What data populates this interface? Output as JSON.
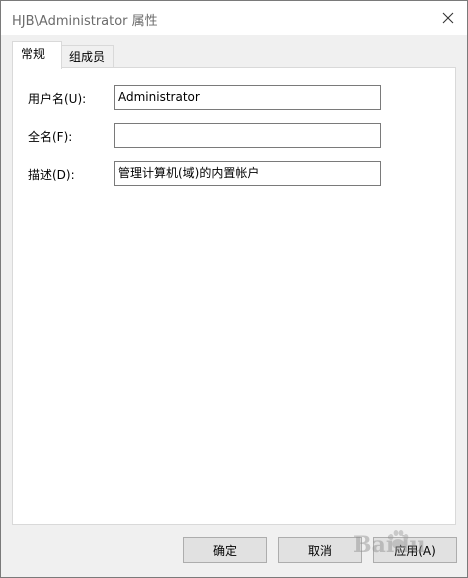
{
  "window": {
    "title": "HJB\\Administrator 属性"
  },
  "tabs": [
    {
      "label": "常规",
      "active": true
    },
    {
      "label": "组成员",
      "active": false
    }
  ],
  "fields": {
    "username": {
      "label": "用户名(U):",
      "value": "Administrator"
    },
    "fullname": {
      "label": "全名(F):",
      "value": ""
    },
    "description": {
      "label": "描述(D):",
      "value": "管理计算机(域)的内置帐户"
    }
  },
  "buttons": {
    "ok": "确定",
    "cancel": "取消",
    "apply": "应用(A)"
  },
  "watermark": {
    "brand": "Baidu"
  },
  "icons": {
    "close": "close-icon",
    "watermark": "paw-logo-icon"
  },
  "colors": {
    "titlebar": "#ffffff",
    "dialog_bg": "#f0f0f0",
    "panel_bg": "#ffffff",
    "border": "#d9d9d9",
    "input_border": "#7a7a7a",
    "button_bg": "#e1e1e1",
    "title_text": "#6b6b6b"
  }
}
